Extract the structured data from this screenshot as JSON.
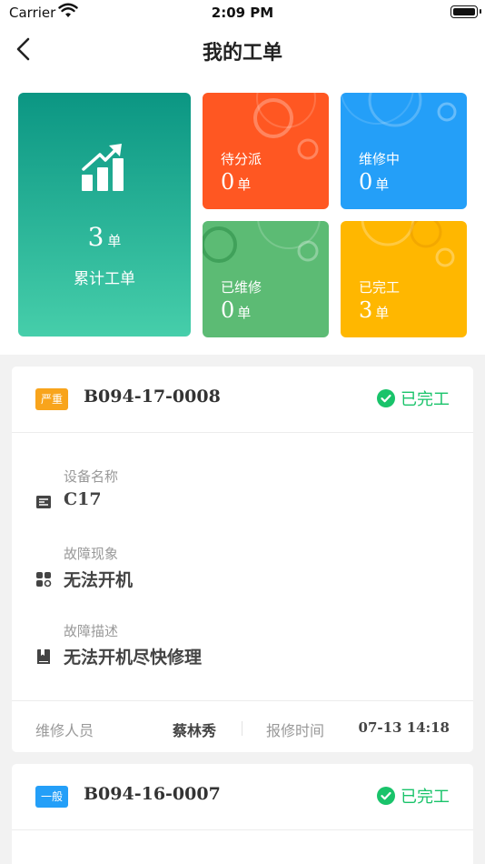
{
  "status_bar": {
    "carrier": "Carrier",
    "time": "2:09 PM"
  },
  "nav": {
    "title": "我的工单"
  },
  "stats": {
    "total": {
      "value": "3",
      "unit": "单",
      "label": "累计工单"
    },
    "pending": {
      "label": "待分派",
      "value": "0",
      "unit": "单"
    },
    "repairing": {
      "label": "维修中",
      "value": "0",
      "unit": "单"
    },
    "repaired": {
      "label": "已维修",
      "value": "0",
      "unit": "单"
    },
    "done": {
      "label": "已完工",
      "value": "3",
      "unit": "单"
    }
  },
  "orders": [
    {
      "priority": "严重",
      "code": "B094-17-0008",
      "status": "已完工",
      "device_label": "设备名称",
      "device": "C17",
      "symptom_label": "故障现象",
      "symptom": "无法开机",
      "desc_label": "故障描述",
      "desc": "无法开机尽快修理",
      "staff_label": "维修人员",
      "staff": "蔡林秀",
      "time_label": "报修时间",
      "time": "07-13 14:18"
    },
    {
      "priority": "一般",
      "code": "B094-16-0007",
      "status": "已完工"
    }
  ],
  "colors": {
    "total": "#0b9683",
    "pending": "#ff5722",
    "repairing": "#249ff8",
    "repaired": "#5cbb74",
    "done": "#ffb700",
    "status_done": "#19c36a"
  }
}
